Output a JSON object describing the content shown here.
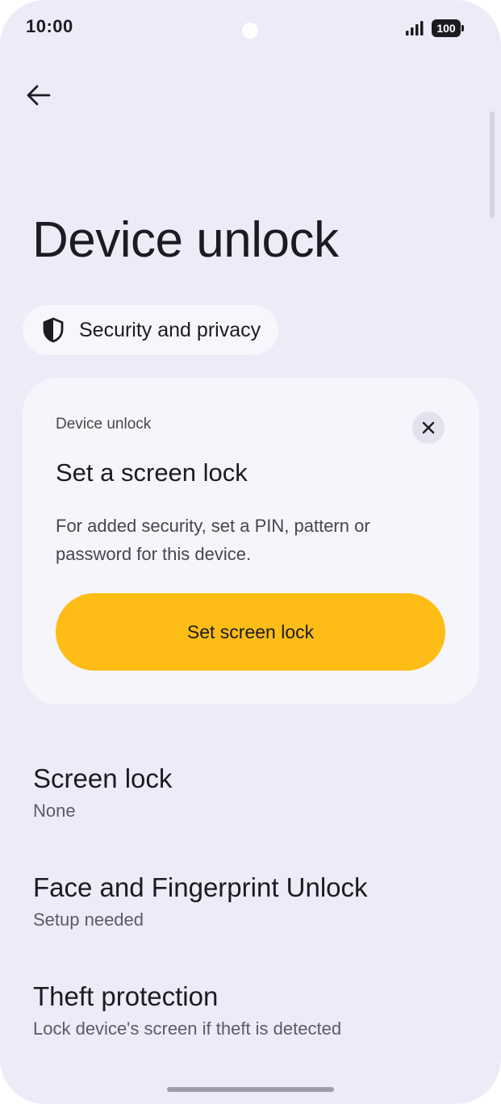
{
  "status_bar": {
    "time": "10:00",
    "battery": "100",
    "icons": [
      "signal-icon",
      "battery-icon"
    ]
  },
  "header": {
    "back_icon": "arrow-left-icon",
    "title": "Device unlock"
  },
  "breadcrumb": {
    "icon": "shield-icon",
    "label": "Security and privacy"
  },
  "card": {
    "eyebrow": "Device unlock",
    "title": "Set a screen lock",
    "body": "For added security, set a PIN, pattern or password for this device.",
    "button_label": "Set screen lock",
    "close_icon": "close-icon",
    "button_color": "#fdbd16"
  },
  "settings": [
    {
      "title": "Screen lock",
      "summary": "None"
    },
    {
      "title": "Face and Fingerprint Unlock",
      "summary": "Setup needed"
    },
    {
      "title": "Theft protection",
      "summary": "Lock device's screen if theft is detected"
    }
  ],
  "colors": {
    "background": "#ecebf8",
    "card": "#f6f5fc",
    "accent": "#fdbd16"
  }
}
